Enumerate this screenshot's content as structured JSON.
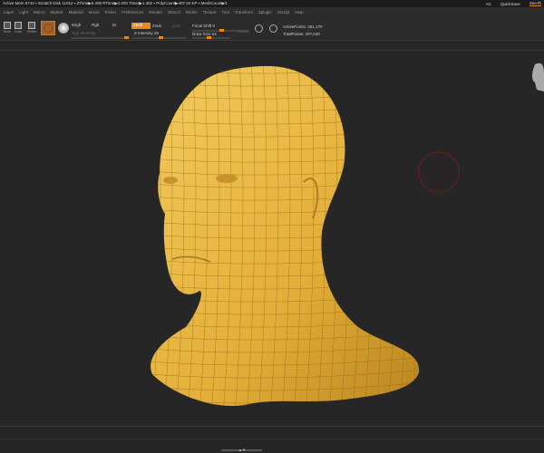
{
  "info": {
    "stats": "Active Mem 5744 ▪ Scratch Disk 11012 ▪ ZTime▶6.408 RTime▶2.203 Timer▶1.482 ▪ PolyCount▶407.04 KP ▪ MeshCount▶2",
    "ac": "AC",
    "quicksave": "QuickSave",
    "see": "See-th"
  },
  "menu": [
    "Layer",
    "Light",
    "Macro",
    "Marker",
    "Material",
    "Movie",
    "Picker",
    "Preferences",
    "Render",
    "Stencil",
    "Stroke",
    "Texture",
    "Tool",
    "Transform",
    "Zplugin",
    "Zscript",
    "Help"
  ],
  "toolbar": {
    "tools": [
      "Move",
      "Scale",
      "Rotate"
    ],
    "mrgb": "Mrgb",
    "rgb": "Rgb",
    "m": "M",
    "rgb_intensity": "Rgb Intensity",
    "zadd": "Zadd",
    "zsub": "Zsub",
    "zcut": "Zcut",
    "z_intensity": "Z Intensity 25",
    "focal_shift": "Focal Shift 0",
    "draw_size": "Draw Size 64",
    "dynamic": "Dynamic",
    "active_points": "ActivePoints: 391,170",
    "total_points": "TotalPoints: 407,040"
  },
  "colors": {
    "accent": "#e8891a",
    "mesh": "#e9b846",
    "background": "#262626"
  },
  "bottom": {
    "scroll_label": "▲▼"
  }
}
